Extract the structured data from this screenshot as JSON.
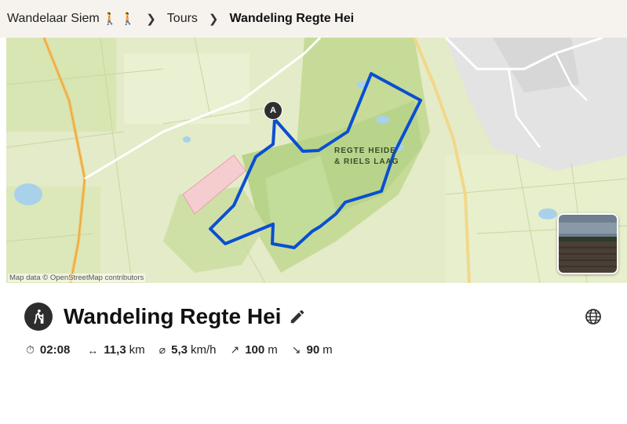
{
  "breadcrumb": {
    "user": "Wandelaar Siem",
    "tours": "Tours",
    "current": "Wandeling Regte Hei"
  },
  "map": {
    "area_label_line1": "REGTE HEIDE",
    "area_label_line2": "& RIELS LAAG",
    "start_marker": "A",
    "attribution": "Map data © OpenStreetMap contributors",
    "route_color": "#0a4fd1"
  },
  "tour": {
    "title": "Wandeling Regte Hei",
    "sport_icon": "hiking-icon"
  },
  "stats": {
    "duration": "02:08",
    "distance_value": "11,3",
    "distance_unit": "km",
    "speed_value": "5,3",
    "speed_unit": "km/h",
    "uphill_value": "100",
    "uphill_unit": "m",
    "downhill_value": "90",
    "downhill_unit": "m"
  }
}
